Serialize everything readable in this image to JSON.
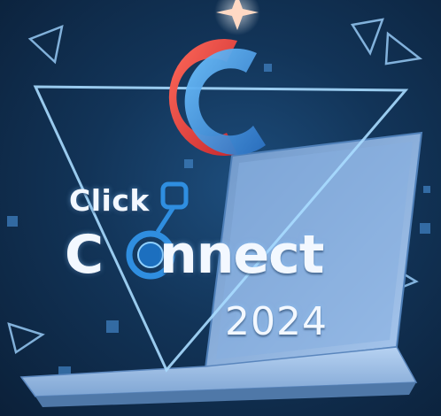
{
  "poster": {
    "title_line1": "Click",
    "title_line2_first": "C",
    "title_line2_rest": "nnect",
    "year": "2024"
  },
  "colors": {
    "background": "#123458",
    "logo_red": "#e2423f",
    "logo_blue": "#3d9fe0",
    "node_blue": "#2f8ee0",
    "neon_line": "#9fd3ff",
    "laptop": "#8fb8e6"
  },
  "icons": [
    "c-logo-icon",
    "connection-node-icon",
    "laptop-icon",
    "triangle-outline-icon",
    "star-flare-icon"
  ]
}
